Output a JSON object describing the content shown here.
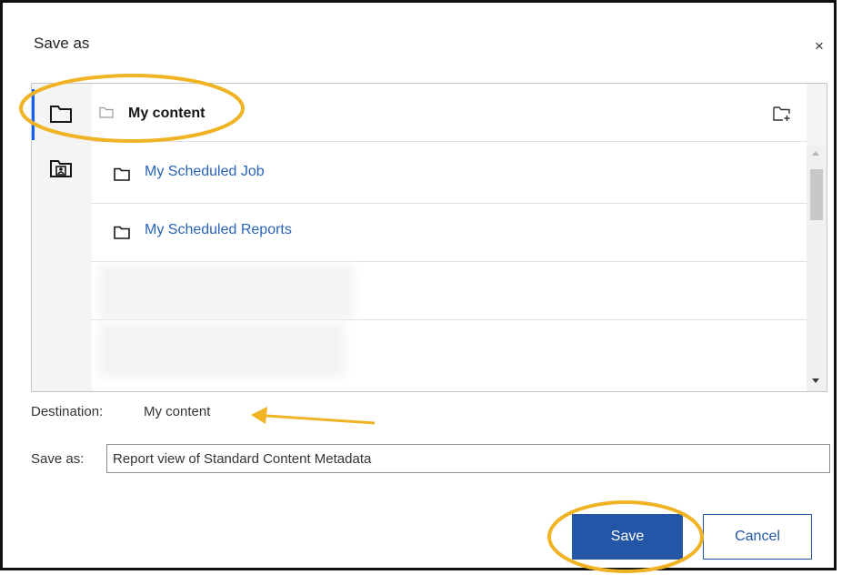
{
  "dialog": {
    "title": "Save as",
    "close_symbol": "×"
  },
  "rail": {
    "items": [
      {
        "icon": "folder-icon",
        "active": true
      },
      {
        "icon": "team-folder-icon",
        "active": false
      }
    ]
  },
  "breadcrumb": {
    "current": "My content"
  },
  "folders": [
    {
      "name": "My Scheduled Job"
    },
    {
      "name": "My Scheduled Reports"
    }
  ],
  "destination": {
    "label": "Destination:",
    "value": "My content"
  },
  "save_as": {
    "label": "Save as:",
    "value": "Report view of Standard Content Metadata"
  },
  "buttons": {
    "save": "Save",
    "cancel": "Cancel"
  },
  "colors": {
    "primary": "#2356a7",
    "link": "#2a64b8",
    "annotation": "#f0b323",
    "rail_active": "#0f62fe"
  }
}
